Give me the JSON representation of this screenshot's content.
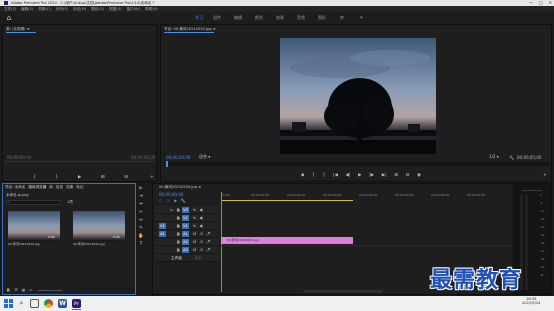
{
  "window": {
    "title": "Adobe Premiere Pro 2020 - C:\\用户\\Unkxp\\文档\\Adobe\\Premiere Pro\\14.0\\未命名 *",
    "controls": [
      "—",
      "□",
      "✕"
    ]
  },
  "menubar": [
    "文件(F)",
    "编辑(E)",
    "剪辑(C)",
    "序列(S)",
    "标记(M)",
    "图形(G)",
    "视图(V)",
    "窗口(W)",
    "帮助(H)"
  ],
  "workspaces": {
    "tabs": [
      "学习",
      "组件",
      "编辑",
      "颜色",
      "效果",
      "音频",
      "图形",
      "库"
    ],
    "active_index": 0,
    "more": "»"
  },
  "source_panel": {
    "tab": "源: (无剪辑) ≡",
    "timecode_left": "00;00;00;00",
    "timecode_right": "00;00;00;00"
  },
  "program_panel": {
    "tab": "节目: 00;黄河20210520.jpg ≡",
    "timecode": "00;00;00;00",
    "fit": "适合",
    "ratio": "1/2",
    "duration": "00;00;05;00",
    "transport": [
      "◆",
      "{",
      "}",
      "|◀",
      "◀|",
      "▶",
      "|▶",
      "▶|",
      "⊞",
      "⊟",
      "◉",
      "+"
    ]
  },
  "project_panel": {
    "tabs": [
      "项目: 未命名",
      "媒体浏览器",
      "库",
      "信息",
      "效果",
      "标记"
    ],
    "project_file": "未命名.prproj",
    "item_count": "1项",
    "items": [
      {
        "name": "00;黄河20210520.jpg",
        "duration": "5;00"
      },
      {
        "name": "00;黄河20210520.jpg",
        "duration": "5;00"
      }
    ]
  },
  "timeline": {
    "tab": "00;黄河20210520.jpg ≡",
    "timecode": "00;00;00;00",
    "ruler": [
      "00;00",
      "00;00;01;00",
      "00;00;02;00",
      "00;00;03;00",
      "00;00;04;00",
      "00;00;05;00",
      "00;00;06;00",
      "00;00;07;00",
      "00;00;08;00"
    ],
    "video_tracks": [
      "V3",
      "V2",
      "V1"
    ],
    "audio_tracks": [
      "A1",
      "A2",
      "A3"
    ],
    "master": "主声道",
    "master_value": "0.0",
    "clip": {
      "label": "00;黄河20210520.jpg",
      "color": "#de7fe0"
    }
  },
  "audio_meter": {
    "labels": [
      "0",
      "-6",
      "-12",
      "-18",
      "-24",
      "-30",
      "-36",
      "-42",
      "-48",
      "-54",
      "dB"
    ]
  },
  "watermark": {
    "text": "最需教育",
    "color": "#1e4fb4"
  },
  "taskbar": {
    "time": "16:35",
    "date": "2021/5/24",
    "apps": [
      "windows-logo",
      "search",
      "task-view",
      "chrome",
      "word",
      "premiere-pro"
    ],
    "start_color": "#1f6fd6"
  }
}
